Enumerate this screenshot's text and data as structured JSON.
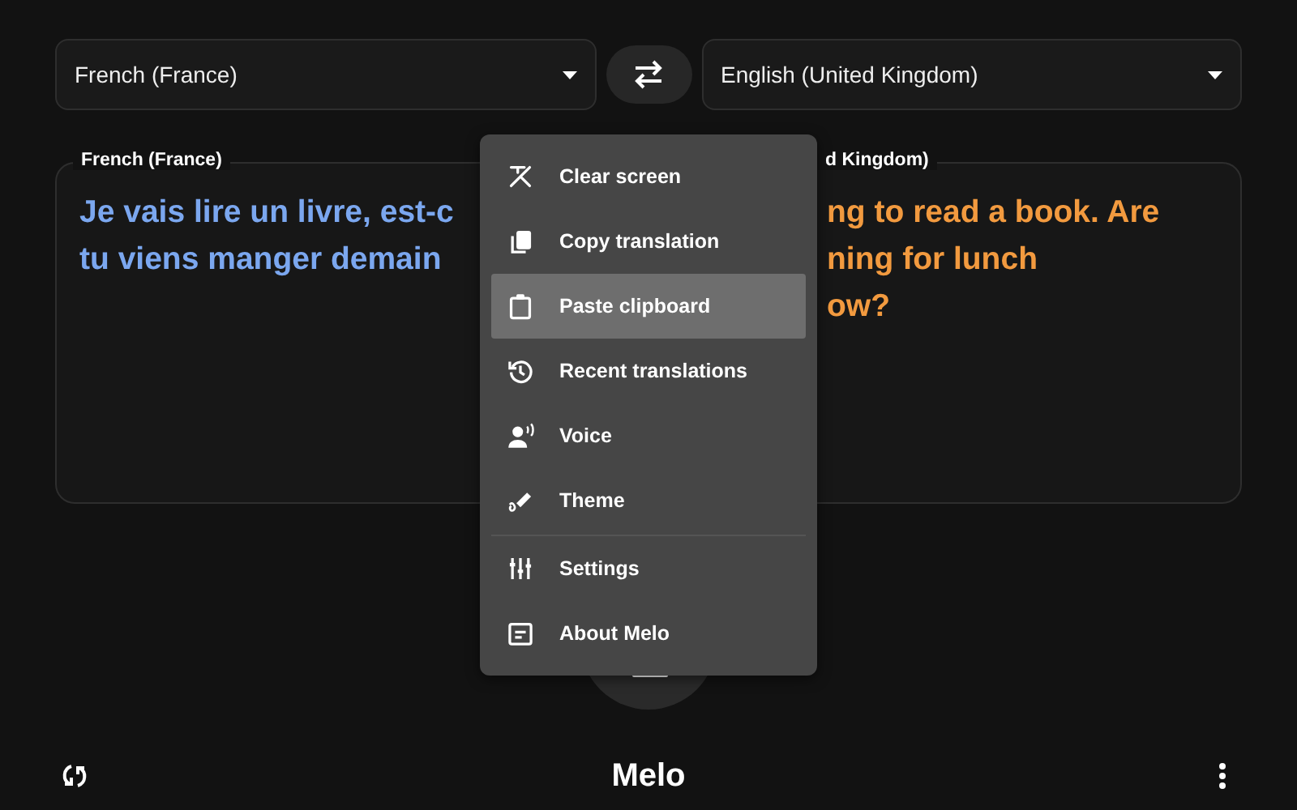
{
  "source_language": {
    "value": "French (France)"
  },
  "target_language": {
    "value": "English (United Kingdom)"
  },
  "panels": [
    {
      "label": "French (France)",
      "lines": [
        "Je vais lire un livre, est-c",
        "tu viens manger demain"
      ],
      "color": "#7ba7ef"
    },
    {
      "label": "d Kingdom)",
      "lines": [
        "ng to read a book. Are",
        "ning for lunch",
        "ow?"
      ],
      "color": "#f29a3f"
    }
  ],
  "menu": [
    {
      "label": "Clear screen",
      "selected": false,
      "divider_before": false
    },
    {
      "label": "Copy translation",
      "selected": false,
      "divider_before": false
    },
    {
      "label": "Paste clipboard",
      "selected": true,
      "divider_before": false
    },
    {
      "label": "Recent translations",
      "selected": false,
      "divider_before": false
    },
    {
      "label": "Voice",
      "selected": false,
      "divider_before": false
    },
    {
      "label": "Theme",
      "selected": false,
      "divider_before": false
    },
    {
      "label": "Settings",
      "selected": false,
      "divider_before": true
    },
    {
      "label": "About Melo",
      "selected": false,
      "divider_before": false
    }
  ],
  "app_title": "Melo"
}
